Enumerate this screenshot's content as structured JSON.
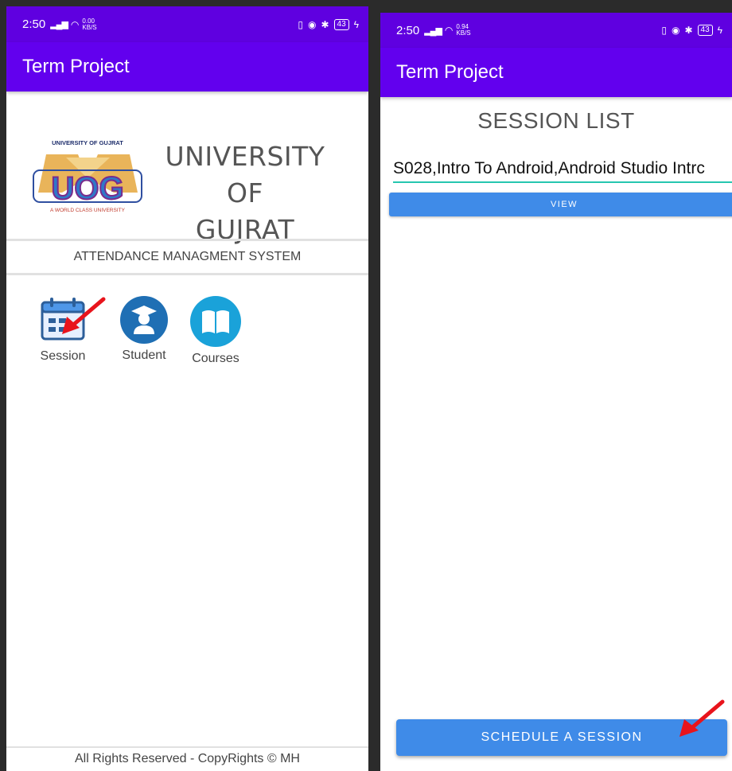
{
  "left_screen": {
    "status": {
      "time": "2:50",
      "speed_value": "0.00",
      "speed_unit": "KB/S",
      "battery": "43"
    },
    "app_title": "Term Project",
    "logo": {
      "top_text": "UNIVERSITY OF GUJRAT",
      "initials": "UOG",
      "tagline": "A WORLD CLASS UNIVERSITY"
    },
    "university_name_line1": "UNIVERSITY OF",
    "university_name_line2": "GUJRAT",
    "system_title": "ATTENDANCE MANAGMENT SYSTEM",
    "menu": [
      {
        "label": "Session",
        "icon": "calendar-icon"
      },
      {
        "label": "Student",
        "icon": "student-icon"
      },
      {
        "label": "Courses",
        "icon": "book-icon"
      }
    ],
    "footer": "All Rights Reserved - CopyRights © MH"
  },
  "right_screen": {
    "status": {
      "time": "2:50",
      "speed_value": "0.94",
      "speed_unit": "KB/S",
      "battery": "43"
    },
    "app_title": "Term Project",
    "heading": "SESSION LIST",
    "session_value": "S028,Intro To Android,Android Studio Intrc",
    "view_label": "VIEW",
    "schedule_label": "SCHEDULE A SESSION"
  },
  "colors": {
    "app_bar": "#6200ee",
    "status_bar": "#5f00e0",
    "button": "#3f8be8",
    "input_underline": "#26c6b0",
    "arrow": "#e8141c"
  }
}
